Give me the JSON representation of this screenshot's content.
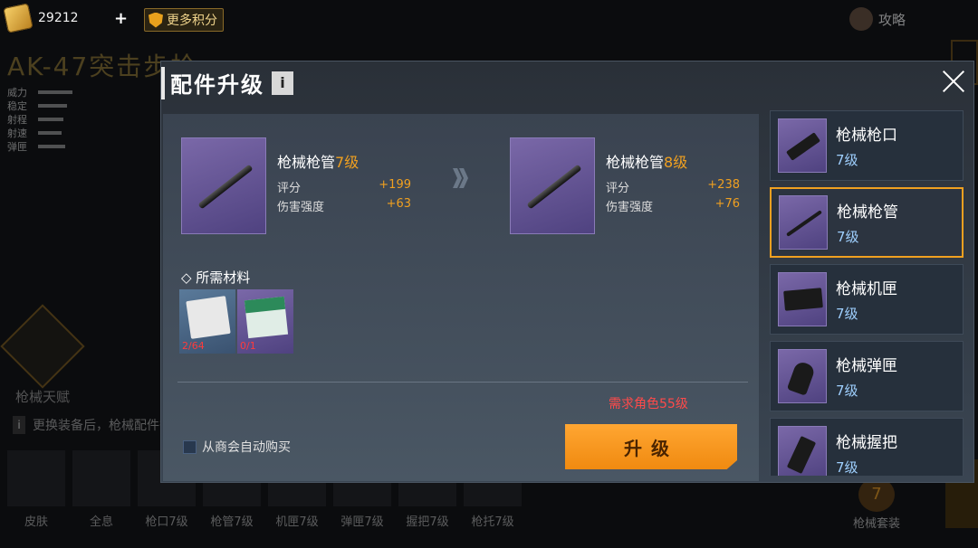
{
  "topbar": {
    "currency_value": "29212",
    "plus_label": "+",
    "more_points_label": "更多积分",
    "guide_label": "攻略"
  },
  "background": {
    "weapon_title": "AK-47突击步枪",
    "stats": [
      "威力",
      "稳定",
      "射程",
      "射速",
      "弹匣"
    ],
    "talent_label": "枪械天赋",
    "tip_icon": "i",
    "tip_text": "更换装备后，枪械配件等级将会保持不变",
    "bottom_tabs": [
      "皮肤",
      "全息",
      "枪口7级",
      "枪管7级",
      "机匣7级",
      "弹匣7级",
      "握把7级",
      "枪托7级"
    ],
    "suit_badge": "7",
    "suit_label": "枪械套装"
  },
  "modal": {
    "title": "配件升级",
    "info_label": "i",
    "current": {
      "name": "枪械枪管",
      "level": "7级",
      "stats": [
        {
          "label": "评分",
          "value": "+199"
        },
        {
          "label": "伤害强度",
          "value": "+63"
        }
      ]
    },
    "next": {
      "name": "枪械枪管",
      "level": "8级",
      "stats": [
        {
          "label": "评分",
          "value": "+238"
        },
        {
          "label": "伤害强度",
          "value": "+76"
        }
      ]
    },
    "materials_title": "◇ 所需材料",
    "materials": [
      {
        "icon": "blueprint-papers-icon",
        "count": "2/64"
      },
      {
        "icon": "green-manual-icon",
        "count": "0/1"
      }
    ],
    "requirement": "需求角色55级",
    "auto_buy_label": "从商会自动购买",
    "upgrade_label": "升级",
    "parts": [
      {
        "name": "枪械枪口",
        "level": "7级",
        "icon": "muzzle-icon"
      },
      {
        "name": "枪械枪管",
        "level": "7级",
        "icon": "barrel-icon",
        "selected": true
      },
      {
        "name": "枪械机匣",
        "level": "7级",
        "icon": "receiver-icon"
      },
      {
        "name": "枪械弹匣",
        "level": "7级",
        "icon": "magazine-icon"
      },
      {
        "name": "枪械握把",
        "level": "7级",
        "icon": "grip-icon"
      }
    ]
  },
  "colors": {
    "accent": "#f0a020",
    "warning": "#ff4a4a",
    "level_blue": "#9fd0ff",
    "button_orange": "#f49a1e"
  }
}
